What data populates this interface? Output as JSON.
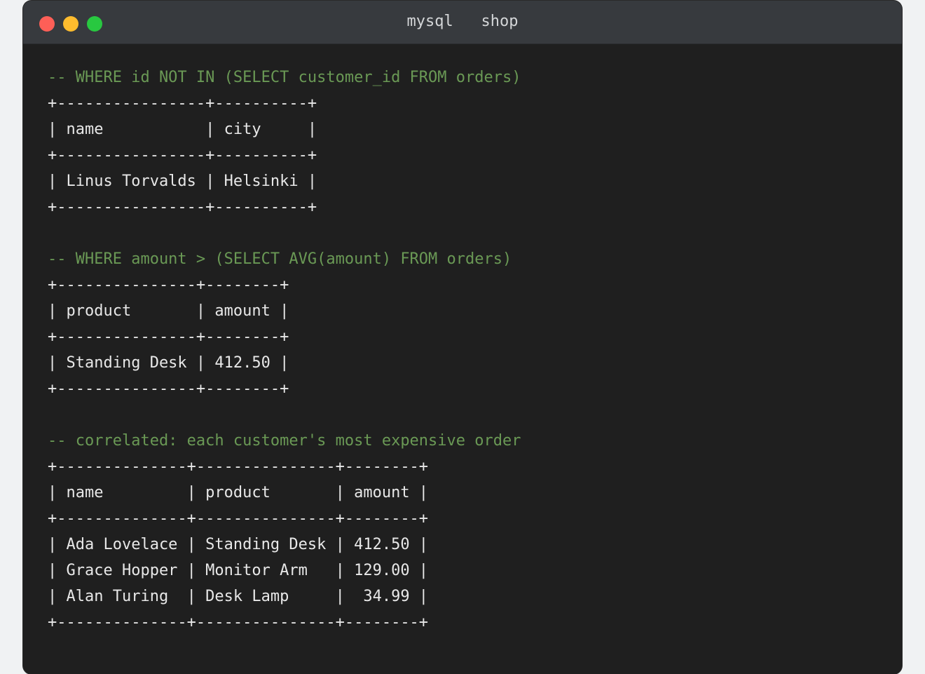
{
  "window": {
    "title": "mysql   shop"
  },
  "blocks": [
    {
      "comment": "-- WHERE id NOT IN (SELECT customer_id FROM orders)",
      "lines": [
        "+----------------+----------+",
        "| name           | city     |",
        "+----------------+----------+",
        "| Linus Torvalds | Helsinki |",
        "+----------------+----------+"
      ]
    },
    {
      "comment": "-- WHERE amount > (SELECT AVG(amount) FROM orders)",
      "lines": [
        "+---------------+--------+",
        "| product       | amount |",
        "+---------------+--------+",
        "| Standing Desk | 412.50 |",
        "+---------------+--------+"
      ]
    },
    {
      "comment": "-- correlated: each customer's most expensive order",
      "lines": [
        "+--------------+---------------+--------+",
        "| name         | product       | amount |",
        "+--------------+---------------+--------+",
        "| Ada Lovelace | Standing Desk | 412.50 |",
        "| Grace Hopper | Monitor Arm   | 129.00 |",
        "| Alan Turing  | Desk Lamp     |  34.99 |",
        "+--------------+---------------+--------+"
      ]
    }
  ],
  "colors": {
    "comment": "#6a9955",
    "text": "#e8e8e8",
    "background": "#1f1f1f",
    "titlebar": "#373a3e"
  }
}
